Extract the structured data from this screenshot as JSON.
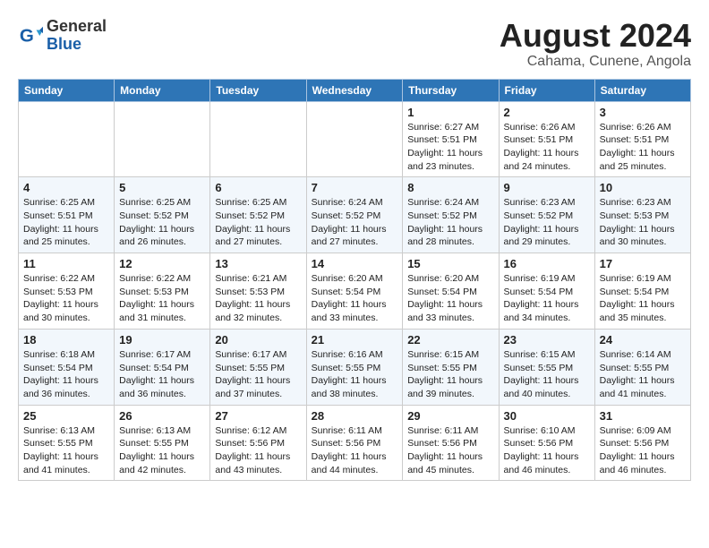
{
  "logo": {
    "general": "General",
    "blue": "Blue"
  },
  "title": {
    "month_year": "August 2024",
    "location": "Cahama, Cunene, Angola"
  },
  "header_days": [
    "Sunday",
    "Monday",
    "Tuesday",
    "Wednesday",
    "Thursday",
    "Friday",
    "Saturday"
  ],
  "weeks": [
    [
      {
        "day": "",
        "info": ""
      },
      {
        "day": "",
        "info": ""
      },
      {
        "day": "",
        "info": ""
      },
      {
        "day": "",
        "info": ""
      },
      {
        "day": "1",
        "info": "Sunrise: 6:27 AM\nSunset: 5:51 PM\nDaylight: 11 hours\nand 23 minutes."
      },
      {
        "day": "2",
        "info": "Sunrise: 6:26 AM\nSunset: 5:51 PM\nDaylight: 11 hours\nand 24 minutes."
      },
      {
        "day": "3",
        "info": "Sunrise: 6:26 AM\nSunset: 5:51 PM\nDaylight: 11 hours\nand 25 minutes."
      }
    ],
    [
      {
        "day": "4",
        "info": "Sunrise: 6:25 AM\nSunset: 5:51 PM\nDaylight: 11 hours\nand 25 minutes."
      },
      {
        "day": "5",
        "info": "Sunrise: 6:25 AM\nSunset: 5:52 PM\nDaylight: 11 hours\nand 26 minutes."
      },
      {
        "day": "6",
        "info": "Sunrise: 6:25 AM\nSunset: 5:52 PM\nDaylight: 11 hours\nand 27 minutes."
      },
      {
        "day": "7",
        "info": "Sunrise: 6:24 AM\nSunset: 5:52 PM\nDaylight: 11 hours\nand 27 minutes."
      },
      {
        "day": "8",
        "info": "Sunrise: 6:24 AM\nSunset: 5:52 PM\nDaylight: 11 hours\nand 28 minutes."
      },
      {
        "day": "9",
        "info": "Sunrise: 6:23 AM\nSunset: 5:52 PM\nDaylight: 11 hours\nand 29 minutes."
      },
      {
        "day": "10",
        "info": "Sunrise: 6:23 AM\nSunset: 5:53 PM\nDaylight: 11 hours\nand 30 minutes."
      }
    ],
    [
      {
        "day": "11",
        "info": "Sunrise: 6:22 AM\nSunset: 5:53 PM\nDaylight: 11 hours\nand 30 minutes."
      },
      {
        "day": "12",
        "info": "Sunrise: 6:22 AM\nSunset: 5:53 PM\nDaylight: 11 hours\nand 31 minutes."
      },
      {
        "day": "13",
        "info": "Sunrise: 6:21 AM\nSunset: 5:53 PM\nDaylight: 11 hours\nand 32 minutes."
      },
      {
        "day": "14",
        "info": "Sunrise: 6:20 AM\nSunset: 5:54 PM\nDaylight: 11 hours\nand 33 minutes."
      },
      {
        "day": "15",
        "info": "Sunrise: 6:20 AM\nSunset: 5:54 PM\nDaylight: 11 hours\nand 33 minutes."
      },
      {
        "day": "16",
        "info": "Sunrise: 6:19 AM\nSunset: 5:54 PM\nDaylight: 11 hours\nand 34 minutes."
      },
      {
        "day": "17",
        "info": "Sunrise: 6:19 AM\nSunset: 5:54 PM\nDaylight: 11 hours\nand 35 minutes."
      }
    ],
    [
      {
        "day": "18",
        "info": "Sunrise: 6:18 AM\nSunset: 5:54 PM\nDaylight: 11 hours\nand 36 minutes."
      },
      {
        "day": "19",
        "info": "Sunrise: 6:17 AM\nSunset: 5:54 PM\nDaylight: 11 hours\nand 36 minutes."
      },
      {
        "day": "20",
        "info": "Sunrise: 6:17 AM\nSunset: 5:55 PM\nDaylight: 11 hours\nand 37 minutes."
      },
      {
        "day": "21",
        "info": "Sunrise: 6:16 AM\nSunset: 5:55 PM\nDaylight: 11 hours\nand 38 minutes."
      },
      {
        "day": "22",
        "info": "Sunrise: 6:15 AM\nSunset: 5:55 PM\nDaylight: 11 hours\nand 39 minutes."
      },
      {
        "day": "23",
        "info": "Sunrise: 6:15 AM\nSunset: 5:55 PM\nDaylight: 11 hours\nand 40 minutes."
      },
      {
        "day": "24",
        "info": "Sunrise: 6:14 AM\nSunset: 5:55 PM\nDaylight: 11 hours\nand 41 minutes."
      }
    ],
    [
      {
        "day": "25",
        "info": "Sunrise: 6:13 AM\nSunset: 5:55 PM\nDaylight: 11 hours\nand 41 minutes."
      },
      {
        "day": "26",
        "info": "Sunrise: 6:13 AM\nSunset: 5:55 PM\nDaylight: 11 hours\nand 42 minutes."
      },
      {
        "day": "27",
        "info": "Sunrise: 6:12 AM\nSunset: 5:56 PM\nDaylight: 11 hours\nand 43 minutes."
      },
      {
        "day": "28",
        "info": "Sunrise: 6:11 AM\nSunset: 5:56 PM\nDaylight: 11 hours\nand 44 minutes."
      },
      {
        "day": "29",
        "info": "Sunrise: 6:11 AM\nSunset: 5:56 PM\nDaylight: 11 hours\nand 45 minutes."
      },
      {
        "day": "30",
        "info": "Sunrise: 6:10 AM\nSunset: 5:56 PM\nDaylight: 11 hours\nand 46 minutes."
      },
      {
        "day": "31",
        "info": "Sunrise: 6:09 AM\nSunset: 5:56 PM\nDaylight: 11 hours\nand 46 minutes."
      }
    ]
  ]
}
